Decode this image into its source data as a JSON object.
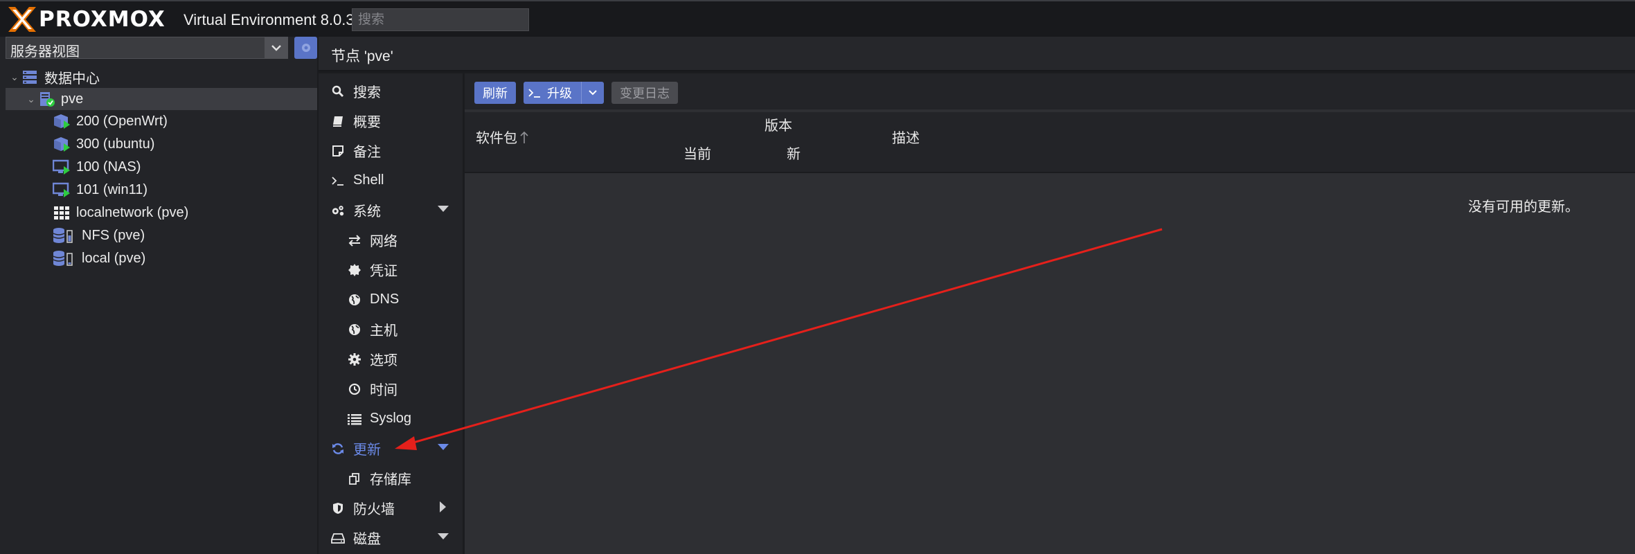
{
  "app": {
    "brand": "PROXMOX",
    "version": "Virtual Environment 8.0.3",
    "search_placeholder": "搜索"
  },
  "tree": {
    "view_selector": "服务器视图",
    "items": [
      {
        "label": "数据中心",
        "icon": "datacenter-icon"
      },
      {
        "label": "pve",
        "icon": "node-online-icon"
      },
      {
        "label": "200 (OpenWrt)",
        "icon": "container-running-icon"
      },
      {
        "label": "300 (ubuntu)",
        "icon": "container-running-icon"
      },
      {
        "label": "100 (NAS)",
        "icon": "vm-running-icon"
      },
      {
        "label": "101 (win11)",
        "icon": "vm-running-icon"
      },
      {
        "label": "localnetwork (pve)",
        "icon": "sdn-network-icon"
      },
      {
        "label": "NFS (pve)",
        "icon": "storage-icon"
      },
      {
        "label": "local (pve)",
        "icon": "storage-icon"
      }
    ]
  },
  "breadcrumb": "节点 'pve'",
  "menu": {
    "items": [
      {
        "label": "搜索",
        "icon": "search-icon"
      },
      {
        "label": "概要",
        "icon": "book-icon"
      },
      {
        "label": "备注",
        "icon": "note-icon"
      },
      {
        "label": "Shell",
        "icon": "terminal-icon"
      },
      {
        "label": "系统",
        "icon": "cogs-icon"
      },
      {
        "label": "网络",
        "icon": "exchange-icon"
      },
      {
        "label": "凭证",
        "icon": "certificate-icon"
      },
      {
        "label": "DNS",
        "icon": "globe-icon"
      },
      {
        "label": "主机",
        "icon": "globe-icon"
      },
      {
        "label": "选项",
        "icon": "gear-icon"
      },
      {
        "label": "时间",
        "icon": "clock-icon"
      },
      {
        "label": "Syslog",
        "icon": "list-icon"
      },
      {
        "label": "更新",
        "icon": "refresh-icon"
      },
      {
        "label": "存储库",
        "icon": "files-icon"
      },
      {
        "label": "防火墙",
        "icon": "shield-icon"
      },
      {
        "label": "磁盘",
        "icon": "hdd-icon"
      }
    ]
  },
  "toolbar": {
    "refresh": "刷新",
    "upgrade": "升级",
    "changelog": "变更日志"
  },
  "grid": {
    "col_package": "软件包",
    "col_version": "版本",
    "col_current": "当前",
    "col_new": "新",
    "col_description": "描述",
    "empty_text": "没有可用的更新。"
  },
  "colors": {
    "accent": "#5a74c7",
    "active_menu": "#6b8ae8",
    "running": "#2ecc40",
    "annotation_arrow": "#e5201b"
  }
}
